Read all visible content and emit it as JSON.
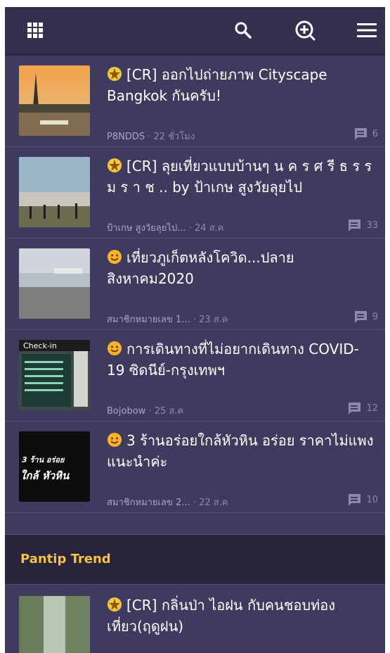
{
  "feed": [
    {
      "title": "[CR] ออกไปถ่ายภาพ Cityscape Bangkok กันครับ!",
      "author": "P8NDDS",
      "time": "22 ชั่วโมง",
      "comments": "6",
      "badge": "star"
    },
    {
      "title": "[CR] ลุยเที่ยวแบบบ้านๆ น ค ร ศ รี ธ ร ร ม ร า ช .. by ป้าเกษ สูงวัยลุยไป",
      "author": "ป้าเกษ สูงวัยลุยไป...",
      "time": "24 ส.ค",
      "comments": "33",
      "badge": "star"
    },
    {
      "title": "เที่ยวภูเก็ตหลังโควิด...ปลาย สิงหาคม2020",
      "author": "สมาชิกหมายเลข 1...",
      "time": "23 ส.ค",
      "comments": "9",
      "badge": "smile"
    },
    {
      "title": "การเดินทางที่ไม่อยากเดินทาง COVID-19 ซิดนีย์-กรุงเทพฯ",
      "author": "Bojobow",
      "time": "25 ส.ค",
      "comments": "12",
      "badge": "smile"
    },
    {
      "title": "3 ร้านอร่อยใกล้หัวหิน อร่อย ราคาไม่แพง แนะนำค่ะ",
      "author": "สมาชิกหมายเลข 2...",
      "time": "22 ส.ค",
      "comments": "10",
      "badge": "smile"
    }
  ],
  "thumb_text": {
    "item1": "Check-in",
    "item4_line1": "3 ร้าน อร่อย",
    "item4_line2": "ใกล้ หัวหิน"
  },
  "trend": {
    "heading": "Pantip Trend",
    "items": [
      {
        "title": "[CR] กลิ่นป่า ไอฝน กับคนชอบท่องเที่ยว(ฤดูฝน)",
        "badge": "star"
      }
    ]
  },
  "icons": {
    "grid": "apps-grid-icon",
    "search": "search-icon",
    "add": "add-topic-icon",
    "menu": "hamburger-menu-icon",
    "comment": "comment-icon"
  },
  "colors": {
    "bg": "#3e3b5e",
    "topbar": "#33304e",
    "trend_heading": "#f6c242"
  }
}
